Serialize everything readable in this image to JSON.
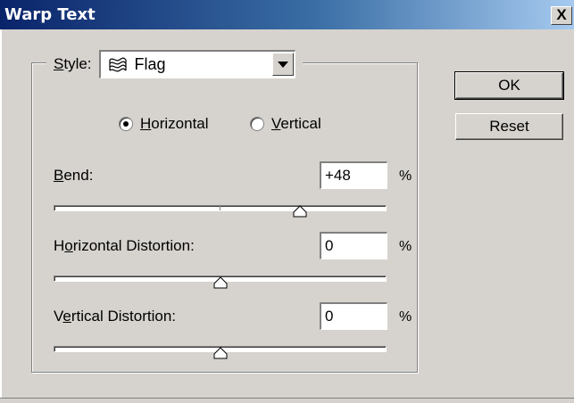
{
  "window": {
    "title": "Warp Text",
    "close_glyph": "X"
  },
  "style": {
    "label_prefix": "",
    "label_mnemonic": "S",
    "label_rest": "tyle:",
    "selected": "Flag",
    "selected_icon": "flag-warp-icon"
  },
  "orientation": {
    "options": [
      {
        "mnemonic": "H",
        "rest": "orizontal",
        "checked": true
      },
      {
        "mnemonic": "V",
        "rest": "ertical",
        "checked": false
      }
    ]
  },
  "fields": {
    "bend": {
      "pre": "",
      "mnemonic": "B",
      "post": "end:",
      "value": "+48",
      "unit": "%",
      "slider_value": 48
    },
    "horizontal_distortion": {
      "pre": "H",
      "mnemonic": "o",
      "post": "rizontal Distortion:",
      "value": "0",
      "unit": "%",
      "slider_value": 0
    },
    "vertical_distortion": {
      "pre": "V",
      "mnemonic": "e",
      "post": "rtical Distortion:",
      "value": "0",
      "unit": "%",
      "slider_value": 0
    }
  },
  "buttons": {
    "ok": "OK",
    "reset": "Reset"
  }
}
